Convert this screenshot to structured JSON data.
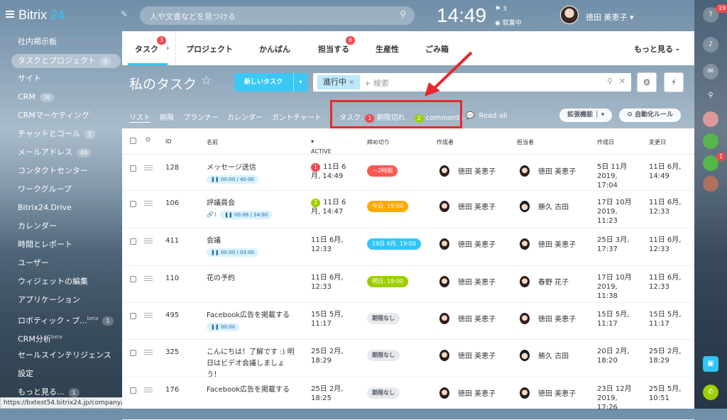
{
  "topbar": {
    "logo_main": "Bitrix",
    "logo_num": "24",
    "search_placeholder": "人や文書などを見つける",
    "clock": "14:49",
    "flag_count": "3",
    "work_status": "就業中",
    "user_name": "徳田 美恵子"
  },
  "sidebar": {
    "items": [
      {
        "label": "社内掲示板"
      },
      {
        "label": "タスクとプロジェクト",
        "count": "3"
      },
      {
        "label": "サイト"
      },
      {
        "label": "CRM",
        "count": "36"
      },
      {
        "label": "CRMマーケティング"
      },
      {
        "label": "チャットとコール",
        "count": "1"
      },
      {
        "label": "メールアドレス",
        "count": "40"
      },
      {
        "label": "コンタクトセンター"
      },
      {
        "label": "ワークグループ"
      },
      {
        "label": "Bitrix24.Drive"
      },
      {
        "label": "カレンダー"
      },
      {
        "label": "時間とレポート"
      },
      {
        "label": "ユーザー"
      },
      {
        "label": "ウィジェットの編集"
      },
      {
        "label": "アプリケーション"
      },
      {
        "label": "ロボティック・プ...",
        "count": "1",
        "tag": "beta"
      },
      {
        "label": "CRM分析",
        "tag": "beta"
      },
      {
        "label": "セールスインテリジェンス"
      },
      {
        "label": "設定"
      },
      {
        "label": "もっと見る...",
        "count": "1"
      }
    ]
  },
  "status_url": "https://bxtest54.bitrix24.jp/company/personal/user/1/tasks/?F_STATE=sV100",
  "tabs": [
    {
      "label": "タスク",
      "badge": "3"
    },
    {
      "label": "プロジェクト"
    },
    {
      "label": "かんばん"
    },
    {
      "label": "担当する",
      "badge": "6"
    },
    {
      "label": "生産性"
    },
    {
      "label": "ごみ箱"
    },
    {
      "label": "もっと見る -"
    }
  ],
  "page_title": "私のタスク",
  "new_task_label": "新しいタスク",
  "filter": {
    "chip": "進行中",
    "placeholder": "+ 検索"
  },
  "views": [
    "リスト",
    "期限",
    "プランナー",
    "カレンダー",
    "ガントチャート"
  ],
  "counters": {
    "label": "タスク:",
    "overdue_count": "1",
    "overdue_label": "期限切れ",
    "comments_count": "2",
    "comments_label": "comments"
  },
  "read_all": "Read all",
  "ext_label": "拡張機能",
  "automation_label": "自動化ルール",
  "right_badges": {
    "help": "19",
    "crm": "1"
  },
  "columns": {
    "id": "ID",
    "name": "名前",
    "active": "ACTIVE",
    "deadline": "締め切り",
    "creator": "作成者",
    "assignee": "担当者",
    "created": "作成日",
    "modified": "変更日"
  },
  "rows": [
    {
      "id": "128",
      "name": "メッセージ送信",
      "timer": "00:00 / 40:00",
      "act_badge": "1",
      "active": "11日 6月, 14:49",
      "deadline": "－2時間",
      "dl_color": "#ff5752",
      "creator": "徳田 美恵子",
      "assignee": "徳田 美恵子",
      "created": "5日 11月 2019, 17:04",
      "modified": "11日 6月, 14:49"
    },
    {
      "id": "106",
      "name": "評議員会",
      "clip": "1",
      "timer": "00:08 / 24:00",
      "act_badge": "2",
      "act_badge_color": "#9dcf00",
      "active": "11日 6月, 14:47",
      "deadline": "今日, 19:00",
      "dl_color": "#ffa900",
      "creator": "徳田 美恵子",
      "assignee": "勝久 古田",
      "created": "17日 10月 2019, 11:23",
      "modified": "11日 6月, 12:33"
    },
    {
      "id": "411",
      "name": "会議",
      "timer": "00:00 / 03:00",
      "active": "11日 6月, 12:33",
      "deadline": "19日 6月, 19:00",
      "dl_color": "#2fc6f6",
      "creator": "徳田 美恵子",
      "assignee": "徳田 美恵子",
      "created": "25日 3月, 17:37",
      "modified": "11日 6月, 12:33"
    },
    {
      "id": "110",
      "name": "花の予約",
      "active": "11日 6月, 12:33",
      "deadline": "明日, 19:00",
      "dl_color": "#9dcf00",
      "creator": "徳田 美恵子",
      "assignee": "春野 花子",
      "created": "17日 10月 2019, 11:38",
      "modified": "11日 6月, 12:33"
    },
    {
      "id": "495",
      "name": "Facebook広告を掲載する",
      "timer": "00:00",
      "active": "15日 5月, 11:17",
      "deadline": "期限なし",
      "dl_color": "#e8ebed",
      "creator": "徳田 美恵子",
      "assignee": "徳田 美恵子",
      "created": "15日 5月, 11:17",
      "modified": "15日 5月, 11:17"
    },
    {
      "id": "325",
      "name": "こんにちは！了解です :) 明日はビデオ会議しましょう！",
      "active": "25日 2月, 18:29",
      "deadline": "期限なし",
      "dl_color": "#e8ebed",
      "creator": "徳田 美恵子",
      "assignee": "勝久 古田",
      "created": "20日 2月, 18:20",
      "modified": "25日 2月, 18:29"
    },
    {
      "id": "176",
      "name": "Facebook広告を掲載する",
      "active": "25日 2月, 18:25",
      "deadline": "期限なし",
      "dl_color": "#e8ebed",
      "creator": "徳田 美恵子",
      "assignee": "徳田 美恵子",
      "created": "23日 12月 2019, 17:26",
      "modified": "25日 5月, 10:51"
    }
  ]
}
